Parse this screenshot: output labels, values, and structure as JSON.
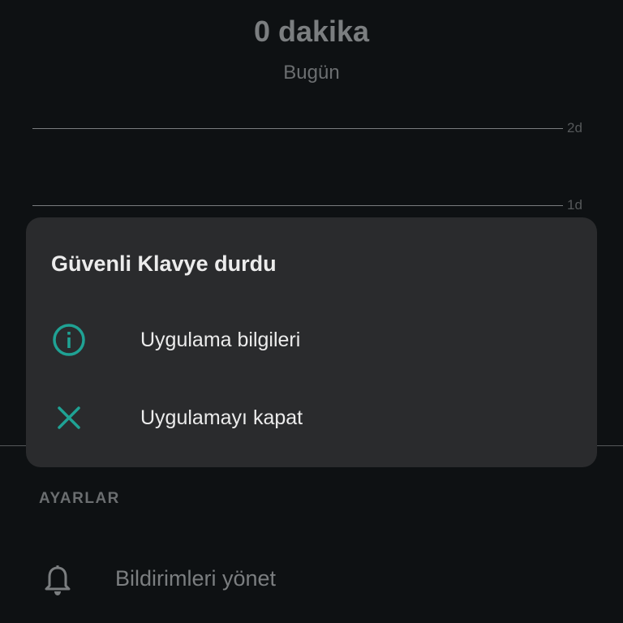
{
  "background": {
    "usage_total": "0 dakika",
    "usage_period": "Bugün",
    "chart_gridlines": [
      {
        "label": "2d"
      },
      {
        "label": "1d"
      }
    ],
    "settings_section": {
      "header": "AYARLAR",
      "items": [
        {
          "label": "Bildirimleri yönet",
          "icon": "bell-icon"
        }
      ]
    }
  },
  "dialog": {
    "title": "Güvenli Klavye durdu",
    "options": [
      {
        "label": "Uygulama bilgileri",
        "icon": "info-icon"
      },
      {
        "label": "Uygulamayı kapat",
        "icon": "close-icon"
      }
    ]
  },
  "colors": {
    "accent": "#1fa294",
    "dialog_bg": "#2a2b2d",
    "screen_bg": "#0e1113"
  }
}
